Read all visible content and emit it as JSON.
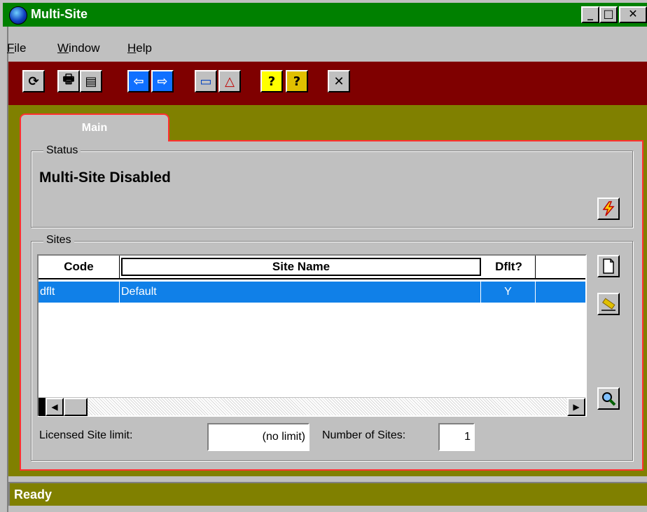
{
  "window": {
    "title": "Multi-Site",
    "min_glyph": "_",
    "max_glyph": "□",
    "close_glyph": "✕",
    "title_color": "#008000"
  },
  "menu": [
    "File",
    "Window",
    "Help"
  ],
  "toolbar": {
    "background": "#7f0000",
    "buttons": [
      {
        "icon": "refresh-icon",
        "glyph": "⟳"
      },
      {
        "icon": "printer-icon",
        "glyph": "🖶"
      },
      {
        "icon": "print-preview-icon",
        "glyph": "▤"
      },
      {
        "icon": "arrow-left-icon",
        "glyph": "⇦"
      },
      {
        "icon": "arrow-right-icon",
        "glyph": "⇨"
      },
      {
        "icon": "open-folder-icon",
        "glyph": "▭"
      },
      {
        "icon": "shapes-icon",
        "glyph": "△"
      },
      {
        "icon": "help-icon",
        "glyph": "?"
      },
      {
        "icon": "context-help-icon",
        "glyph": "?"
      },
      {
        "icon": "close-icon",
        "glyph": "✕"
      }
    ]
  },
  "tab": {
    "label": "Main"
  },
  "status_group": {
    "label": "Status",
    "text": "Multi-Site Disabled",
    "action_icon": "lightning-icon"
  },
  "sites_group": {
    "label": "Sites",
    "columns": [
      "Code",
      "Site Name",
      "Dflt?"
    ],
    "rows": [
      {
        "code": "dflt",
        "name": "Default",
        "dflt": "Y"
      }
    ],
    "side_icons": [
      "new-document-icon",
      "eraser-icon",
      "magnifier-icon"
    ],
    "scroll_left": "◀",
    "scroll_right": "▶",
    "licensed_label": "Licensed Site limit:",
    "licensed_value": "(no limit)",
    "count_label": "Number of Sites:",
    "count_value": "1"
  },
  "statusbar": {
    "text": "Ready"
  },
  "colors": {
    "accent_red": "#ff3030",
    "olive": "#808000",
    "selection": "#1080e8"
  }
}
